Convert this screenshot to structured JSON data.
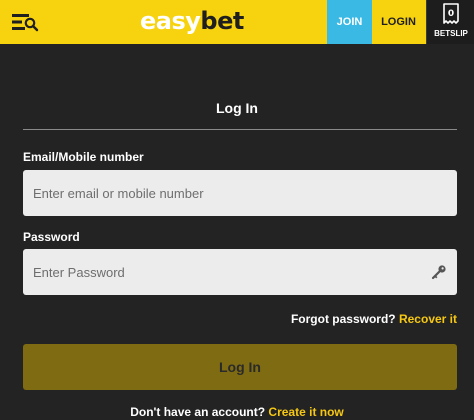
{
  "header": {
    "logo_left": "easy",
    "logo_right": "bet",
    "join_label": "JOIN",
    "login_label": "LOGIN",
    "betslip_label": "BETSLIP",
    "betslip_count": "0",
    "menu_icon": "menu-search-icon"
  },
  "form": {
    "title": "Log In",
    "email_label": "Email/Mobile number",
    "email_placeholder": "Enter email or mobile number",
    "password_label": "Password",
    "password_placeholder": "Enter Password",
    "forgot_text": "Forgot password?",
    "recover_link": "Recover it",
    "submit_label": "Log In",
    "no_account_text": "Don't have an account?",
    "create_link": "Create it now"
  },
  "colors": {
    "brand_yellow": "#f6d20f",
    "join_blue": "#3ab9e5",
    "background": "#232323",
    "link_yellow": "#f6c813",
    "submit_disabled": "#7e6b12"
  }
}
